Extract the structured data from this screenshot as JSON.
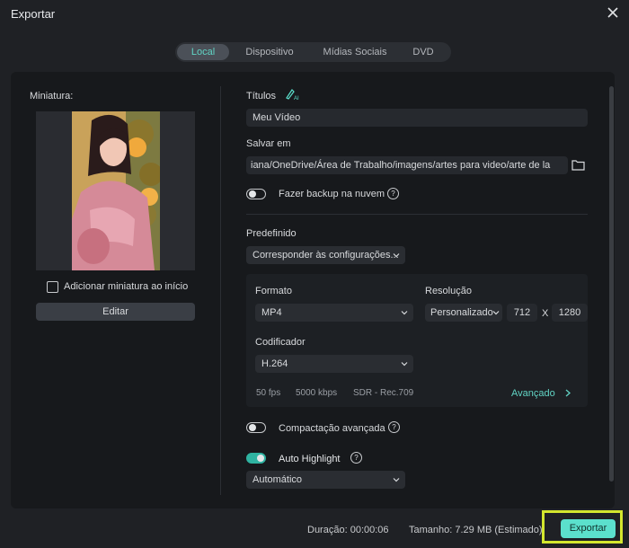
{
  "dialog": {
    "title": "Exportar"
  },
  "tabs": [
    "Local",
    "Dispositivo",
    "Mídias Sociais",
    "DVD"
  ],
  "left": {
    "thumbnail_label": "Miniatura:",
    "add_thumbnail_label": "Adicionar miniatura ao início",
    "edit_label": "Editar"
  },
  "form": {
    "title_label": "Títulos",
    "title_value": "Meu Vídeo",
    "save_label": "Salvar em",
    "save_path": "iana/OneDrive/Área de Trabalho/imagens/artes para video/arte de la",
    "backup_label": "Fazer backup na nuvem",
    "preset_label": "Predefinido",
    "preset_value": "Corresponder às configurações...",
    "format_label": "Formato",
    "format_value": "MP4",
    "resolution_label": "Resolução",
    "resolution_value": "Personalizado",
    "width": "712",
    "x_sep": "X",
    "height": "1280",
    "encoder_label": "Codificador",
    "encoder_value": "H.264",
    "fps": "50 fps",
    "bitrate": "5000 kbps",
    "color": "SDR - Rec.709",
    "advanced_label": "Avançado",
    "compact_label": "Compactação avançada",
    "highlight_label": "Auto Highlight",
    "highlight_value": "Automático"
  },
  "footer": {
    "duration_label": "Duração:",
    "duration_value": "00:00:06",
    "size_label": "Tamanho:",
    "size_value": "7.29 MB (Estimado)",
    "export_label": "Exportar"
  },
  "colors": {
    "accent": "#5be0cc",
    "highlight_border": "#d3e62e"
  }
}
